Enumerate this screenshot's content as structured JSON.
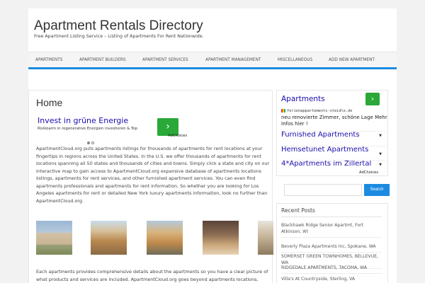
{
  "site": {
    "title": "Apartment Rentals Directory",
    "description": "Free Apartment Listing Service – Listing of Apartments For Rent Nationwide."
  },
  "nav": {
    "items": [
      {
        "label": "Apartments"
      },
      {
        "label": "Apartment Builders"
      },
      {
        "label": "Apartment Services"
      },
      {
        "label": "Apartment Management"
      },
      {
        "label": "Miscellaneous"
      },
      {
        "label": "Add New Apartment"
      }
    ]
  },
  "main": {
    "page_title": "Home",
    "ad": {
      "title": "Invest in grüne Energie",
      "subtitle": "Risikoarm in regenerative Energien investieren & Top",
      "go_icon": "chevron-right-icon",
      "adchoices": "AdChoices"
    },
    "paragraph1": "ApartmentCloud.org puts apartments listings for thousands of apartments for rent locations at your fingertips in regions across the United States. In the U.S. we offer thousands of apartments for rent locations spanning all 50 states and thousands of cities and towns. Simply click a state and city on our interactive map to gain access to ApartmentCloud.org expansive database of apartments locations listings, apartments for rent services, and other furnished apartment services. You can even find apartments professionals and apartments for rent information. So whether you are looking for Los Angeles apartments for rent or detailed New York luxury apartments information, look no further than ApartmentCloud.org.",
    "paragraph2": "Each apartments provides comprehensive details about the apartments so you have a clear picture of what products and services are included. ApartmentCloud.org goes beyond apartments locations, however, with access to apartments for rent tools and resources such as"
  },
  "sidebar": {
    "ad": {
      "title": "Apartments",
      "url": "ferienappartements-steidle.de",
      "description": "neu renovierte Zimmer, schöne Lage Mehr Infos hier !",
      "links": [
        {
          "label": "Furnished Apartments"
        },
        {
          "label": "Hemsetunet Apartments"
        },
        {
          "label": "4*Apartments im Zillertal"
        }
      ],
      "adchoices": "AdChoices"
    },
    "search": {
      "placeholder": "",
      "button_label": "Search"
    },
    "recent": {
      "title": "Recent Posts",
      "items": [
        {
          "label": "Blackhawk Ridge Senior Apartmt, Fort Atkinson, WI"
        },
        {
          "label": "Beverly Plaza Apartments Inc, Spokane, WA"
        },
        {
          "label": "SOMERSET GREEN TOWNHOMES, BELLEVUE, WA"
        },
        {
          "label": "RIDGEDALE APARTMENTS, TACOMA, WA"
        },
        {
          "label": "Villa's At Countryside, Sterling, VA"
        }
      ]
    }
  },
  "colors": {
    "accent": "#1b8be0",
    "ad_link": "#1a0dab",
    "ad_button": "#2aa838"
  }
}
